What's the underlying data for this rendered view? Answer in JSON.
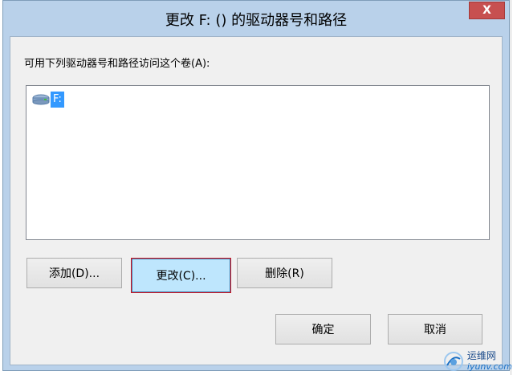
{
  "dialog": {
    "title": "更改 F: () 的驱动器号和路径",
    "close_label": "X"
  },
  "list": {
    "caption": "可用下列驱动器号和路径访问这个卷(A):",
    "items": [
      {
        "label": "F:",
        "icon": "drive-icon",
        "selected": true
      }
    ]
  },
  "buttons": {
    "add": "添加(D)...",
    "change": "更改(C)...",
    "delete": "删除(R)",
    "ok": "确定",
    "cancel": "取消"
  },
  "watermark": {
    "cn": "运维网",
    "en": "iyunv.com"
  },
  "colors": {
    "selection": "#3399ff",
    "close": "#c75050",
    "focus_outline": "#d4111c",
    "frame": "#b9d1ea"
  }
}
